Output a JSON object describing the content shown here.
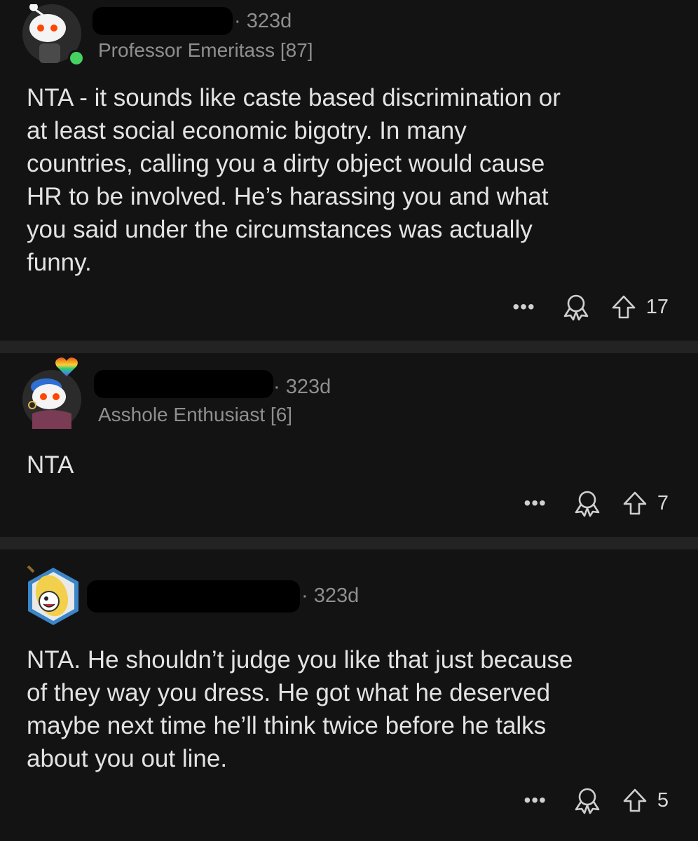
{
  "comments": [
    {
      "age": "· 323d",
      "flair": "Professor Emeritass [87]",
      "body_lines": [
        "NTA - it sounds like caste based discrimination or",
        "at least social economic bigotry. In many",
        "countries, calling you a dirty object would cause",
        "HR to be involved. He’s harassing you and what",
        "you said under the circumstances was actually",
        "funny."
      ],
      "more": "•••",
      "votes": "17",
      "online": true
    },
    {
      "age": "· 323d",
      "flair": "Asshole Enthusiast [6]",
      "body_lines": [
        "NTA"
      ],
      "more": "•••",
      "votes": "7"
    },
    {
      "age": "· 323d",
      "flair": "",
      "body_lines": [
        "NTA. He shouldn’t judge you like that just because",
        "of they way you dress. He got what he deserved",
        "maybe next time he’ll think twice before he talks",
        "about you out line."
      ],
      "more": "•••",
      "votes": "5"
    }
  ],
  "colors": {
    "background": "#0b0b0b",
    "card": "#131313",
    "meta_text": "#8f8f8f",
    "body_text": "#e3e3e3",
    "online_dot": "#46d160"
  },
  "icons": [
    "snoo-avatar-icon",
    "online-indicator-icon",
    "award-icon",
    "upvote-arrow-icon",
    "more-options-icon",
    "pride-heart-icon",
    "banana-badge-icon"
  ]
}
